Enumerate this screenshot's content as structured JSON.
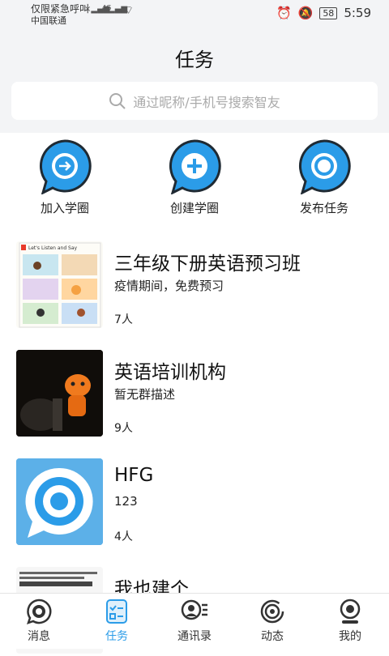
{
  "status_bar": {
    "carrier_line1": "仅限紧急呼叫",
    "carrier_line2": "中国联通",
    "network": "4G",
    "battery": "58",
    "time": "5:59"
  },
  "header": {
    "title": "任务"
  },
  "search": {
    "placeholder": "通过昵称/手机号搜索智友"
  },
  "actions": [
    {
      "label": "加入学圈",
      "icon": "arrow-right-icon"
    },
    {
      "label": "创建学圈",
      "icon": "plus-icon"
    },
    {
      "label": "发布任务",
      "icon": "target-icon"
    }
  ],
  "groups": [
    {
      "name": "三年级下册英语预习班",
      "desc": "疫情期间，免费预习",
      "count": "7人",
      "thumb_text": "Let's Listen and Say"
    },
    {
      "name": "英语培训机构",
      "desc": "暂无群描述",
      "count": "9人"
    },
    {
      "name": "HFG",
      "desc": "123",
      "count": "4人"
    },
    {
      "name": "我也建个",
      "desc": "",
      "count": ""
    }
  ],
  "tabs": [
    {
      "label": "消息",
      "icon": "message-icon"
    },
    {
      "label": "任务",
      "icon": "task-icon"
    },
    {
      "label": "通讯录",
      "icon": "contacts-icon"
    },
    {
      "label": "动态",
      "icon": "moments-icon"
    },
    {
      "label": "我的",
      "icon": "profile-icon"
    }
  ],
  "colors": {
    "accent": "#2b9ce8",
    "dark": "#1f2a33"
  }
}
